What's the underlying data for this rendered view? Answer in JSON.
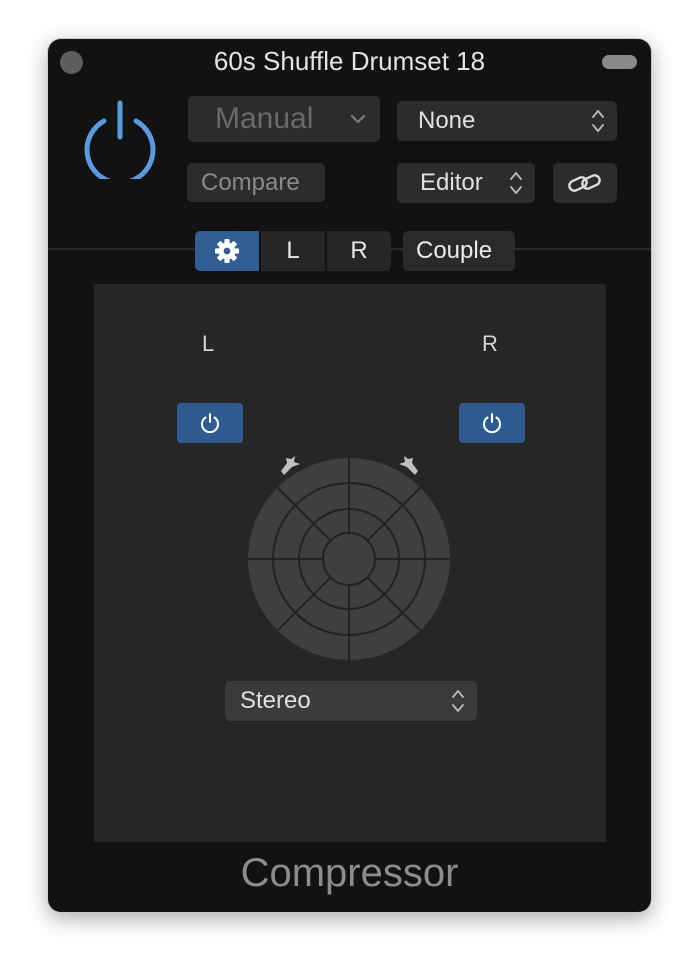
{
  "window": {
    "title": "60s Shuffle Drumset 18"
  },
  "header": {
    "preset_label": "Manual",
    "none_select": "None",
    "compare_label": "Compare",
    "view_select": "Editor"
  },
  "segmented": {
    "items": [
      "L",
      "R"
    ],
    "couple_label": "Couple"
  },
  "surround": {
    "left_label": "L",
    "right_label": "R",
    "format_select": "Stereo"
  },
  "footer": {
    "plugin_name": "Compressor"
  },
  "colors": {
    "accent": "#5a9ae0",
    "active": "#2f5d94",
    "panel": "#262626"
  },
  "icons": [
    "power-icon",
    "chevron-down-icon",
    "updown-arrows-icon",
    "link-icon",
    "gear-icon",
    "speaker-icon"
  ]
}
